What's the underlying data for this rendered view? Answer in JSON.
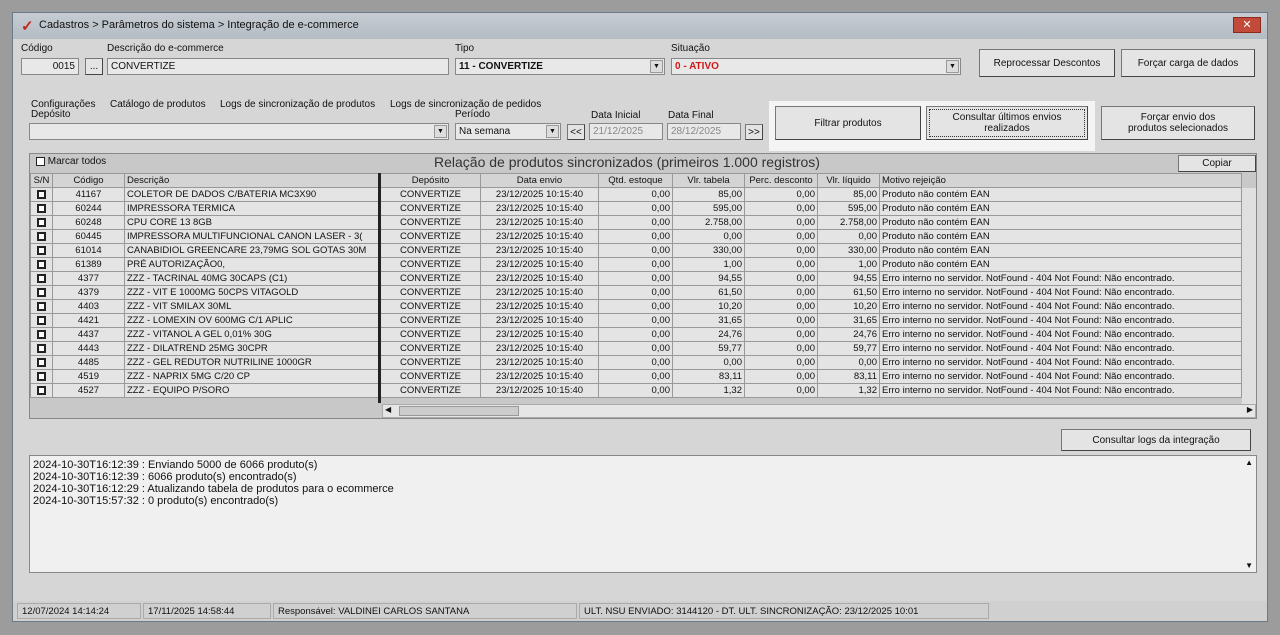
{
  "title": "Cadastros > Parâmetros do sistema > Integração de e-commerce",
  "form": {
    "codigo_label": "Código",
    "codigo": "0015",
    "descricao_label": "Descrição do e-commerce",
    "descricao": "CONVERTIZE",
    "tipo_label": "Tipo",
    "tipo": "11 - CONVERTIZE",
    "situacao_label": "Situação",
    "situacao": "0 - ATIVO",
    "situacao_color": "#d01818",
    "reprocessar": "Reprocessar Descontos",
    "forcar_carga": "Forçar carga de dados"
  },
  "tabs": [
    "Configurações",
    "Catálogo de produtos",
    "Logs de sincronização de produtos",
    "Logs de sincronização de pedidos"
  ],
  "filters": {
    "deposito_label": "Depósito",
    "deposito": "",
    "periodo_label": "Período",
    "periodo": "Na semana",
    "prev": "<<",
    "next": ">>",
    "data_inicial_label": "Data Inicial",
    "data_inicial": "21/12/2025",
    "data_final_label": "Data Final",
    "data_final": "28/12/2025",
    "filtrar": "Filtrar produtos",
    "consultar": "Consultar últimos envios realizados",
    "forcar_envio": "Forçar envio dos produtos selecionados"
  },
  "grid": {
    "marcar_todos": "Marcar todos",
    "title": "Relação de produtos sincronizados (primeiros 1.000 registros)",
    "copiar": "Copiar",
    "columns": [
      "S/N",
      "Código",
      "Descrição",
      "Depósito",
      "Data envio",
      "Qtd. estoque",
      "Vlr. tabela",
      "Perc. desconto",
      "Vlr. líquido",
      "Motivo rejeição"
    ],
    "rows": [
      [
        "41167",
        "COLETOR DE DADOS C/BATERIA MC3X90",
        "CONVERTIZE",
        "23/12/2025 10:15:40",
        "0,00",
        "85,00",
        "0,00",
        "85,00",
        "Produto não contém EAN"
      ],
      [
        "60244",
        "IMPRESSORA TERMICA",
        "CONVERTIZE",
        "23/12/2025 10:15:40",
        "0,00",
        "595,00",
        "0,00",
        "595,00",
        "Produto não contém EAN"
      ],
      [
        "60248",
        "CPU CORE 13 8GB",
        "CONVERTIZE",
        "23/12/2025 10:15:40",
        "0,00",
        "2.758,00",
        "0,00",
        "2.758,00",
        "Produto não contém EAN"
      ],
      [
        "60445",
        "IMPRESSORA MULTIFUNCIONAL CANON LASER - 3(",
        "CONVERTIZE",
        "23/12/2025 10:15:40",
        "0,00",
        "0,00",
        "0,00",
        "0,00",
        "Produto não contém EAN"
      ],
      [
        "61014",
        "CANABIDIOL GREENCARE 23,79MG SOL GOTAS 30M",
        "CONVERTIZE",
        "23/12/2025 10:15:40",
        "0,00",
        "330,00",
        "0,00",
        "330,00",
        "Produto não contém EAN"
      ],
      [
        "61389",
        "PRÉ AUTORIZAÇÃO0,",
        "CONVERTIZE",
        "23/12/2025 10:15:40",
        "0,00",
        "1,00",
        "0,00",
        "1,00",
        "Produto não contém EAN"
      ],
      [
        "4377",
        "ZZZ - TACRINAL 40MG 30CAPS (C1)",
        "CONVERTIZE",
        "23/12/2025 10:15:40",
        "0,00",
        "94,55",
        "0,00",
        "94,55",
        "Erro interno no servidor. NotFound - 404 Not Found: Não encontrado."
      ],
      [
        "4379",
        "ZZZ - VIT E 1000MG 50CPS VITAGOLD",
        "CONVERTIZE",
        "23/12/2025 10:15:40",
        "0,00",
        "61,50",
        "0,00",
        "61,50",
        "Erro interno no servidor. NotFound - 404 Not Found: Não encontrado."
      ],
      [
        "4403",
        "ZZZ - VIT SMILAX 30ML",
        "CONVERTIZE",
        "23/12/2025 10:15:40",
        "0,00",
        "10,20",
        "0,00",
        "10,20",
        "Erro interno no servidor. NotFound - 404 Not Found: Não encontrado."
      ],
      [
        "4421",
        "ZZZ - LOMEXIN OV 600MG C/1 APLIC",
        "CONVERTIZE",
        "23/12/2025 10:15:40",
        "0,00",
        "31,65",
        "0,00",
        "31,65",
        "Erro interno no servidor. NotFound - 404 Not Found: Não encontrado."
      ],
      [
        "4437",
        "ZZZ - VITANOL A GEL 0,01% 30G",
        "CONVERTIZE",
        "23/12/2025 10:15:40",
        "0,00",
        "24,76",
        "0,00",
        "24,76",
        "Erro interno no servidor. NotFound - 404 Not Found: Não encontrado."
      ],
      [
        "4443",
        "ZZZ - DILATREND 25MG 30CPR",
        "CONVERTIZE",
        "23/12/2025 10:15:40",
        "0,00",
        "59,77",
        "0,00",
        "59,77",
        "Erro interno no servidor. NotFound - 404 Not Found: Não encontrado."
      ],
      [
        "4485",
        "ZZZ - GEL REDUTOR NUTRILINE 1000GR",
        "CONVERTIZE",
        "23/12/2025 10:15:40",
        "0,00",
        "0,00",
        "0,00",
        "0,00",
        "Erro interno no servidor. NotFound - 404 Not Found: Não encontrado."
      ],
      [
        "4519",
        "ZZZ - NAPRIX 5MG C/20 CP",
        "CONVERTIZE",
        "23/12/2025 10:15:40",
        "0,00",
        "83,11",
        "0,00",
        "83,11",
        "Erro interno no servidor. NotFound - 404 Not Found: Não encontrado."
      ],
      [
        "4527",
        "ZZZ - EQUIPO P/SORO",
        "CONVERTIZE",
        "23/12/2025 10:15:40",
        "0,00",
        "1,32",
        "0,00",
        "1,32",
        "Erro interno no servidor. NotFound - 404 Not Found: Não encontrado."
      ]
    ]
  },
  "logs": {
    "consultar": "Consultar logs da integração",
    "lines": [
      "2024-10-30T16:12:39 : Enviando 5000 de 6066 produto(s)",
      "2024-10-30T16:12:39 : 6066 produto(s) encontrado(s)",
      "2024-10-30T16:12:29 : Atualizando tabela de produtos para o ecommerce",
      "2024-10-30T15:57:32 : 0 produto(s) encontrado(s)"
    ]
  },
  "status": [
    "12/07/2024 14:14:24",
    "17/11/2025 14:58:44",
    "Responsável: VALDINEI CARLOS SANTANA",
    "ULT. NSU ENVIADO: 3144120 - DT. ULT. SINCRONIZAÇÃO: 23/12/2025 10:01"
  ]
}
